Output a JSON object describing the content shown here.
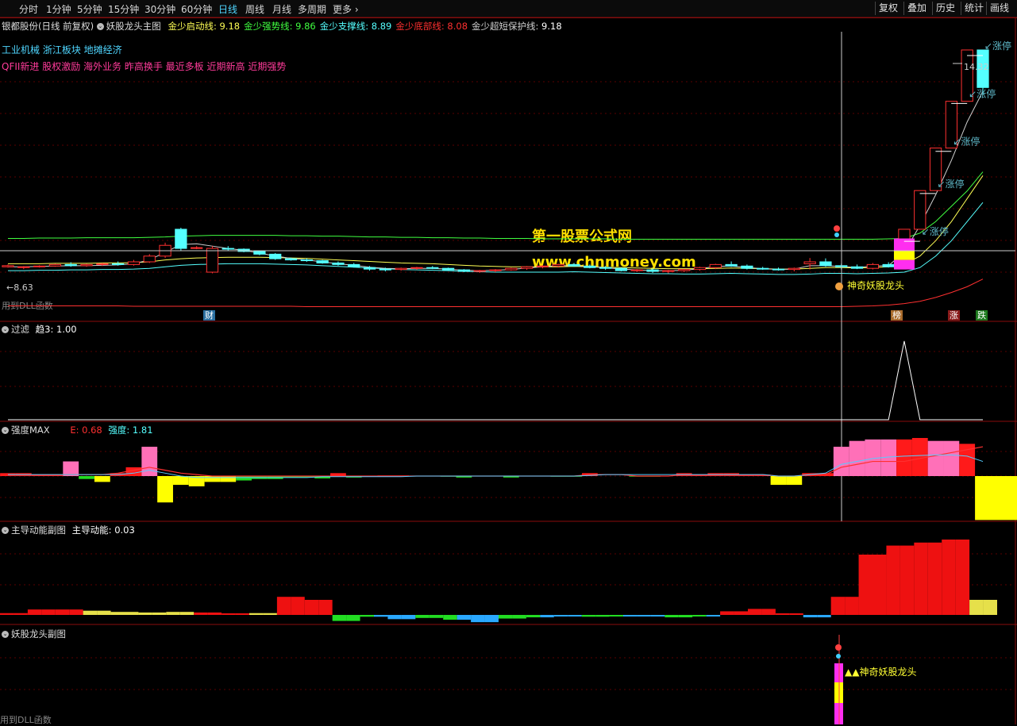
{
  "toolbar": {
    "periods": [
      "分时",
      "1分钟",
      "5分钟",
      "15分钟",
      "30分钟",
      "60分钟",
      "日线",
      "周线",
      "月线",
      "多周期",
      "更多"
    ],
    "active_period": "日线",
    "buttons": [
      "复权",
      "叠加",
      "历史",
      "统计",
      "画线"
    ]
  },
  "main": {
    "stock": "银都股份(日线 前复权)",
    "formula_name": "妖股龙头主图",
    "indicators": [
      {
        "label": "金少启动线:",
        "value": "9.18",
        "color": "#ffff55"
      },
      {
        "label": "金少强势线:",
        "value": "9.86",
        "color": "#40ff40"
      },
      {
        "label": "金少支撑线:",
        "value": "8.89",
        "color": "#55ffff"
      },
      {
        "label": "金少底部线:",
        "value": "8.08",
        "color": "#ff3030"
      },
      {
        "label": "金少超短保护线:",
        "value": "9.18",
        "color": "#d0d0d0"
      }
    ],
    "sectors": "工业机械 浙江板块 地摊经济",
    "concepts": "QFII新进 股权激励 海外业务 昨高换手 最近多板 近期新高 近期强势",
    "dll_note": "用到DLL函数",
    "low_price": "8.63",
    "high_price": "14.32",
    "limit_up": "涨停",
    "signal_label": "神奇妖股龙头",
    "watermark_title": "第一股票公式网",
    "watermark_url": "www.chnmoney.com",
    "badge_cai": "财",
    "badge_bang": "榜",
    "badge_zhang": "涨",
    "badge_die": "跌"
  },
  "panel_filter": {
    "title": "过滤",
    "label": "趋3:",
    "value": "1.00"
  },
  "panel_strength": {
    "title": "强度MAX",
    "e_label": "E:",
    "e_value": "0.68",
    "s_label": "强度:",
    "s_value": "1.81"
  },
  "panel_energy": {
    "title": "主导动能副图",
    "label": "主导动能:",
    "value": "0.03"
  },
  "panel_sub": {
    "title": "妖股龙头副图",
    "signal": "▲▲神奇妖股龙头",
    "dll_note": "用到DLL函数"
  },
  "colors": {
    "up": "#ff3030",
    "down": "#54ffff",
    "grid": "#5a0000",
    "crosshair": "#cccccc"
  },
  "chart_data": [
    {
      "type": "candlestick",
      "title": "妖股龙头主图",
      "ylim": [
        7.8,
        14.8
      ],
      "candles": [
        [
          9.12,
          9.18,
          9.1,
          9.15
        ],
        [
          9.1,
          9.14,
          9.06,
          9.12
        ],
        [
          9.12,
          9.16,
          9.1,
          9.14
        ],
        [
          9.14,
          9.2,
          9.12,
          9.18
        ],
        [
          9.18,
          9.24,
          9.12,
          9.15
        ],
        [
          9.15,
          9.2,
          9.12,
          9.18
        ],
        [
          9.18,
          9.22,
          9.14,
          9.2
        ],
        [
          9.2,
          9.26,
          9.15,
          9.18
        ],
        [
          9.18,
          9.3,
          9.15,
          9.25
        ],
        [
          9.25,
          9.45,
          9.22,
          9.4
        ],
        [
          9.4,
          9.75,
          9.35,
          9.68
        ],
        [
          10.1,
          10.14,
          9.55,
          9.6
        ],
        [
          9.62,
          9.66,
          9.58,
          9.62
        ],
        [
          8.98,
          9.66,
          8.95,
          9.6
        ],
        [
          9.6,
          9.66,
          9.55,
          9.58
        ],
        [
          9.58,
          9.6,
          9.5,
          9.52
        ],
        [
          9.52,
          9.55,
          9.42,
          9.45
        ],
        [
          9.45,
          9.48,
          9.3,
          9.33
        ],
        [
          9.33,
          9.36,
          9.28,
          9.3
        ],
        [
          9.3,
          9.34,
          9.25,
          9.28
        ],
        [
          9.28,
          9.3,
          9.2,
          9.22
        ],
        [
          9.22,
          9.26,
          9.15,
          9.18
        ],
        [
          9.18,
          9.22,
          9.1,
          9.12
        ],
        [
          9.1,
          9.14,
          9.02,
          9.06
        ],
        [
          9.06,
          9.1,
          9.0,
          9.05
        ],
        [
          9.05,
          9.1,
          9.02,
          9.08
        ],
        [
          9.08,
          9.12,
          9.04,
          9.1
        ],
        [
          9.1,
          9.14,
          9.06,
          9.08
        ],
        [
          9.08,
          9.1,
          9.02,
          9.04
        ],
        [
          9.04,
          9.06,
          8.98,
          9.0
        ],
        [
          9.0,
          9.04,
          8.96,
          9.02
        ],
        [
          9.02,
          9.06,
          8.98,
          9.04
        ],
        [
          9.04,
          9.1,
          9.02,
          9.08
        ],
        [
          9.08,
          9.14,
          9.04,
          9.12
        ],
        [
          9.12,
          9.16,
          9.08,
          9.14
        ],
        [
          9.14,
          9.2,
          9.1,
          9.18
        ],
        [
          9.18,
          9.22,
          9.12,
          9.14
        ],
        [
          9.14,
          9.18,
          9.08,
          9.1
        ],
        [
          9.1,
          9.14,
          9.04,
          9.08
        ],
        [
          9.08,
          9.1,
          9.0,
          9.02
        ],
        [
          9.02,
          9.06,
          8.98,
          9.04
        ],
        [
          9.04,
          9.08,
          8.96,
          9.0
        ],
        [
          9.0,
          9.04,
          8.95,
          9.02
        ],
        [
          9.02,
          9.06,
          8.98,
          9.05
        ],
        [
          9.05,
          9.12,
          9.02,
          9.1
        ],
        [
          9.1,
          9.2,
          9.06,
          9.18
        ],
        [
          9.18,
          9.26,
          9.12,
          9.14
        ],
        [
          9.14,
          9.18,
          9.05,
          9.08
        ],
        [
          9.08,
          9.12,
          9.04,
          9.06
        ],
        [
          9.06,
          9.1,
          9.02,
          9.04
        ],
        [
          9.05,
          9.1,
          9.0,
          9.08
        ],
        [
          9.2,
          9.35,
          9.05,
          9.25
        ],
        [
          9.25,
          9.34,
          9.12,
          9.15
        ],
        [
          9.15,
          9.2,
          9.05,
          9.12
        ],
        [
          9.12,
          9.18,
          9.06,
          9.08
        ],
        [
          9.08,
          9.22,
          9.05,
          9.18
        ],
        [
          9.18,
          9.24,
          9.1,
          9.12
        ],
        [
          9.18,
          10.1,
          9.15,
          10.1
        ],
        [
          10.1,
          11.11,
          10.1,
          11.11
        ],
        [
          11.11,
          12.22,
          11.11,
          12.22
        ],
        [
          12.22,
          13.44,
          12.22,
          13.44
        ],
        [
          13.44,
          14.78,
          13.44,
          14.78
        ],
        [
          14.78,
          14.32,
          13.6,
          13.8
        ]
      ],
      "series": [
        {
          "name": "金少启动线",
          "color": "#ffff55",
          "values": [
            9.2,
            9.2,
            9.2,
            9.21,
            9.21,
            9.21,
            9.22,
            9.22,
            9.23,
            9.25,
            9.3,
            9.33,
            9.35,
            9.36,
            9.37,
            9.37,
            9.37,
            9.36,
            9.35,
            9.34,
            9.32,
            9.3,
            9.28,
            9.26,
            9.24,
            9.22,
            9.21,
            9.2,
            9.18,
            9.16,
            9.14,
            9.13,
            9.12,
            9.12,
            9.12,
            9.12,
            9.13,
            9.12,
            9.11,
            9.1,
            9.09,
            9.08,
            9.07,
            9.07,
            9.07,
            9.08,
            9.09,
            9.08,
            9.07,
            9.06,
            9.06,
            9.08,
            9.1,
            9.1,
            9.09,
            9.1,
            9.12,
            9.18,
            9.4,
            9.8,
            10.3,
            10.9,
            11.5
          ]
        },
        {
          "name": "金少强势线",
          "color": "#40ff40",
          "values": [
            9.86,
            9.86,
            9.87,
            9.87,
            9.87,
            9.88,
            9.88,
            9.88,
            9.88,
            9.89,
            9.9,
            9.92,
            9.93,
            9.94,
            9.94,
            9.94,
            9.94,
            9.94,
            9.93,
            9.93,
            9.92,
            9.92,
            9.91,
            9.9,
            9.9,
            9.89,
            9.89,
            9.88,
            9.88,
            9.87,
            9.87,
            9.86,
            9.86,
            9.86,
            9.85,
            9.85,
            9.85,
            9.85,
            9.85,
            9.84,
            9.84,
            9.84,
            9.84,
            9.84,
            9.84,
            9.84,
            9.84,
            9.84,
            9.84,
            9.84,
            9.84,
            9.84,
            9.84,
            9.84,
            9.84,
            9.84,
            9.85,
            9.86,
            10.0,
            10.3,
            10.7,
            11.1,
            11.6
          ]
        },
        {
          "name": "金少支撑线",
          "color": "#55ffff",
          "values": [
            9.02,
            9.02,
            9.03,
            9.03,
            9.04,
            9.04,
            9.05,
            9.05,
            9.06,
            9.08,
            9.12,
            9.16,
            9.18,
            9.19,
            9.2,
            9.2,
            9.2,
            9.19,
            9.18,
            9.17,
            9.15,
            9.13,
            9.11,
            9.09,
            9.07,
            9.05,
            9.04,
            9.03,
            9.02,
            9.0,
            8.99,
            8.98,
            8.98,
            8.98,
            8.98,
            8.98,
            8.99,
            8.98,
            8.97,
            8.96,
            8.95,
            8.94,
            8.94,
            8.93,
            8.93,
            8.94,
            8.95,
            8.94,
            8.93,
            8.92,
            8.92,
            8.93,
            8.95,
            8.95,
            8.94,
            8.95,
            8.96,
            8.98,
            9.1,
            9.4,
            9.8,
            10.3,
            10.8
          ]
        },
        {
          "name": "金少底部线",
          "color": "#ff3030",
          "values": [
            8.1,
            8.1,
            8.1,
            8.1,
            8.1,
            8.1,
            8.1,
            8.1,
            8.09,
            8.09,
            8.09,
            8.09,
            8.09,
            8.09,
            8.09,
            8.09,
            8.09,
            8.09,
            8.09,
            8.08,
            8.08,
            8.08,
            8.08,
            8.08,
            8.08,
            8.08,
            8.08,
            8.08,
            8.08,
            8.08,
            8.08,
            8.08,
            8.08,
            8.08,
            8.08,
            8.08,
            8.08,
            8.08,
            8.08,
            8.08,
            8.08,
            8.08,
            8.08,
            8.08,
            8.08,
            8.08,
            8.08,
            8.08,
            8.08,
            8.08,
            8.08,
            8.08,
            8.08,
            8.08,
            8.09,
            8.1,
            8.12,
            8.16,
            8.22,
            8.32,
            8.45,
            8.6,
            8.8
          ]
        },
        {
          "name": "金少超短保护线",
          "color": "#d0d0d0",
          "values": [
            9.12,
            9.12,
            9.13,
            9.14,
            9.15,
            9.15,
            9.16,
            9.17,
            9.2,
            9.3,
            9.5,
            9.7,
            9.72,
            9.66,
            9.6,
            9.55,
            9.48,
            9.4,
            9.34,
            9.3,
            9.25,
            9.2,
            9.16,
            9.11,
            9.08,
            9.07,
            9.08,
            9.08,
            9.06,
            9.03,
            9.02,
            9.03,
            9.05,
            9.09,
            9.12,
            9.15,
            9.15,
            9.12,
            9.1,
            9.06,
            9.04,
            9.02,
            9.02,
            9.03,
            9.07,
            9.13,
            9.14,
            9.1,
            9.07,
            9.05,
            9.06,
            9.15,
            9.15,
            9.13,
            9.1,
            9.14,
            9.15,
            9.5,
            10.2,
            11.0,
            11.9,
            12.9,
            13.7
          ]
        }
      ]
    },
    {
      "type": "line",
      "title": "过滤",
      "ylim": [
        0,
        1.1
      ],
      "values": [
        0,
        0,
        0,
        0,
        0,
        0,
        0,
        0,
        0,
        0,
        0,
        0,
        0,
        0,
        0,
        0,
        0,
        0,
        0,
        0,
        0,
        0,
        0,
        0,
        0,
        0,
        0,
        0,
        0,
        0,
        0,
        0,
        0,
        0,
        0,
        0,
        0,
        0,
        0,
        0,
        0,
        0,
        0,
        0,
        0,
        0,
        0,
        0,
        0,
        0,
        0,
        0,
        0,
        0,
        0,
        0,
        0,
        1,
        0,
        0,
        0,
        0,
        0
      ]
    },
    {
      "type": "bar",
      "title": "强度MAX",
      "ylim": [
        -1.5,
        1.5
      ],
      "values": [
        0.1,
        0.1,
        0.05,
        0.05,
        0.5,
        -0.1,
        -0.2,
        0.1,
        0.3,
        1.0,
        -0.9,
        -0.3,
        -0.35,
        -0.2,
        -0.2,
        -0.15,
        -0.1,
        -0.1,
        -0.05,
        -0.05,
        -0.08,
        0.1,
        -0.05,
        -0.02,
        0.02,
        0.02,
        0.0,
        0.0,
        -0.02,
        -0.05,
        0.0,
        0.0,
        -0.05,
        0.0,
        0.0,
        -0.02,
        -0.02,
        0.1,
        0.0,
        0.0,
        -0.02,
        -0.02,
        0.0,
        0.1,
        0.05,
        0.1,
        0.1,
        0.05,
        0.05,
        -0.3,
        -0.3,
        0.1,
        0.1,
        1.0,
        1.2,
        1.25,
        1.25,
        1.25,
        1.3,
        1.2,
        1.2,
        1.1,
        -1.5
      ],
      "e_values": [
        0.05,
        0.05,
        0.05,
        0.05,
        0.05,
        0.05,
        0.05,
        0.1,
        0.2,
        0.3,
        0.2,
        0.1,
        0.05,
        0.0,
        0.0,
        0.0,
        0.0,
        0.0,
        0.0,
        0.0,
        0.0,
        0.0,
        0.0,
        0.0,
        0.0,
        0.0,
        0.0,
        0.0,
        0.0,
        0.0,
        0.0,
        0.0,
        0.0,
        0.0,
        0.0,
        0.0,
        0.0,
        0.05,
        0.05,
        0.05,
        0.0,
        0.0,
        0.0,
        0.05,
        0.05,
        0.05,
        0.05,
        0.05,
        0.05,
        0.0,
        0.0,
        0.05,
        0.05,
        0.3,
        0.4,
        0.5,
        0.5,
        0.5,
        0.6,
        0.7,
        0.8,
        0.9,
        1.0
      ],
      "s_values": [
        0.05,
        0.05,
        0.05,
        0.05,
        0.05,
        0.05,
        0.05,
        0.05,
        0.1,
        0.2,
        0.1,
        0.0,
        -0.05,
        -0.05,
        -0.05,
        -0.05,
        -0.05,
        -0.05,
        -0.05,
        -0.05,
        -0.02,
        -0.02,
        -0.02,
        -0.02,
        -0.02,
        -0.02,
        0.0,
        0.0,
        0.0,
        0.0,
        0.0,
        0.0,
        0.0,
        0.0,
        0.0,
        0.0,
        0.0,
        0.02,
        0.05,
        0.05,
        0.05,
        0.05,
        0.05,
        0.05,
        0.05,
        0.05,
        0.05,
        0.05,
        0.05,
        0.0,
        0.0,
        0.05,
        0.1,
        0.4,
        0.5,
        0.6,
        0.65,
        0.68,
        0.7,
        0.72,
        0.72,
        0.68,
        0.5
      ]
    },
    {
      "type": "bar",
      "title": "主导动能副图",
      "ylim": [
        -0.15,
        1.2
      ],
      "values": [
        0.03,
        0.03,
        0.09,
        0.09,
        0.09,
        0.09,
        0.07,
        0.07,
        0.05,
        0.05,
        0.04,
        0.04,
        0.05,
        0.05,
        0.04,
        0.04,
        0.02,
        0.02,
        0.03,
        0.03,
        0.3,
        0.3,
        0.25,
        0.25,
        -0.1,
        -0.1,
        -0.03,
        -0.03,
        -0.07,
        -0.07,
        -0.05,
        -0.05,
        -0.08,
        -0.08,
        -0.12,
        -0.12,
        -0.06,
        -0.06,
        -0.04,
        -0.04,
        -0.02,
        -0.02,
        -0.03,
        -0.03,
        -0.02,
        -0.02,
        -0.01,
        -0.01,
        -0.04,
        -0.04,
        -0.02,
        -0.02,
        0.06,
        0.06,
        0.1,
        0.1,
        0.0,
        0.0,
        -0.04,
        -0.04,
        0.3,
        0.3,
        1.0,
        1.0,
        1.15,
        1.15,
        1.2,
        1.2,
        1.25,
        1.25,
        0.25,
        0.25
      ]
    }
  ]
}
